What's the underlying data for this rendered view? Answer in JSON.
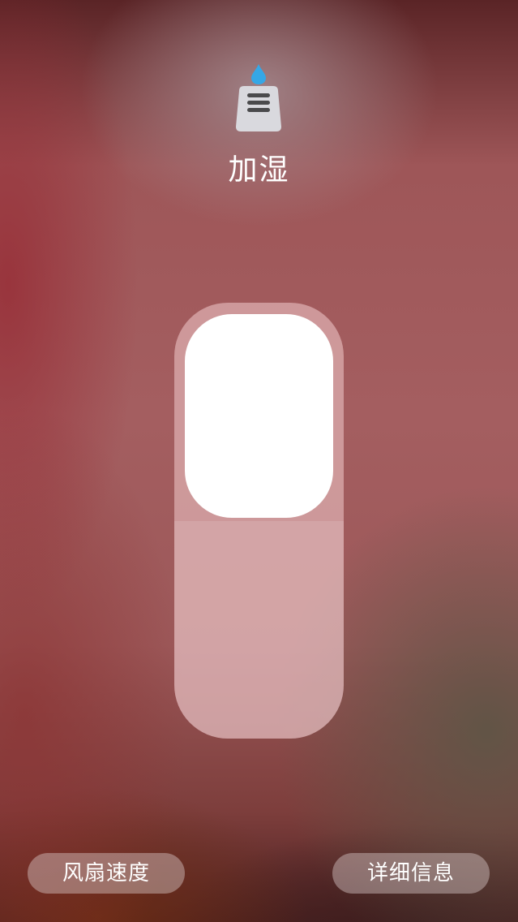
{
  "device": {
    "icon": "humidifier-icon",
    "title": "加湿"
  },
  "slider": {
    "level_percent": 0.5
  },
  "buttons": {
    "fan_speed": "风扇速度",
    "details": "详细信息"
  },
  "colors": {
    "water_drop": "#35a7e6",
    "icon_body": "#d9d9de",
    "icon_lines": "#4a4a4c"
  }
}
